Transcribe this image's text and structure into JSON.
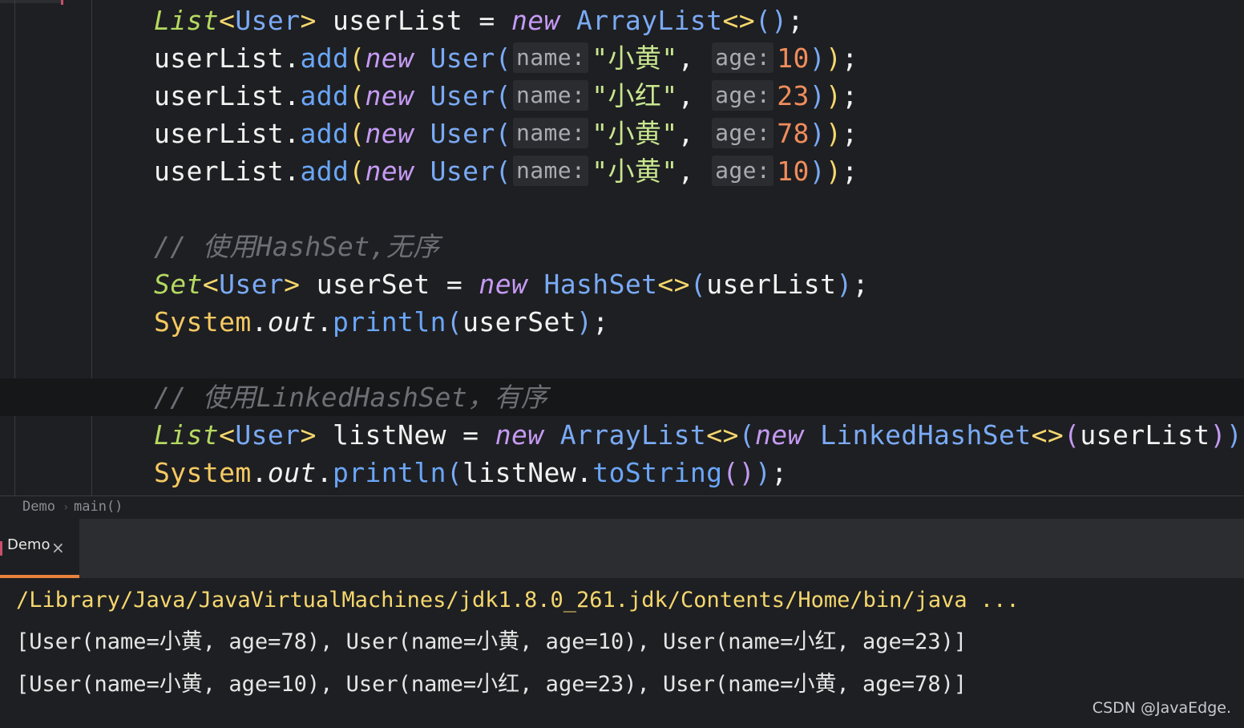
{
  "editor": {
    "lines": [
      {
        "tokens": [
          [
            "t-iface",
            "List"
          ],
          [
            "t-bracket-y",
            "<"
          ],
          [
            "t-type",
            "User"
          ],
          [
            "t-bracket-y",
            "> "
          ],
          [
            "t-var",
            "userList "
          ],
          [
            "t-punct",
            "= "
          ],
          [
            "t-kw",
            "new "
          ],
          [
            "t-type",
            "ArrayList"
          ],
          [
            "t-bracket-y",
            "<>"
          ],
          [
            "t-bracket-b",
            "()"
          ],
          [
            "t-punct",
            ";"
          ]
        ]
      },
      {
        "tokens": [
          [
            "t-var",
            "userList"
          ],
          [
            "t-punct",
            "."
          ],
          [
            "t-method",
            "add"
          ],
          [
            "t-bracket-y",
            "("
          ],
          [
            "t-kw",
            "new "
          ],
          [
            "t-type",
            "User"
          ],
          [
            "t-bracket-b",
            "("
          ]
        ],
        "hint1": "name:",
        "str": "\"小黄\"",
        "sep": ",",
        "hint2": "age:",
        "num": "10",
        "end": [
          [
            "t-bracket-b",
            ")"
          ],
          [
            "t-bracket-y",
            ")"
          ],
          [
            "t-punct",
            ";"
          ]
        ]
      },
      {
        "tokens": [
          [
            "t-var",
            "userList"
          ],
          [
            "t-punct",
            "."
          ],
          [
            "t-method",
            "add"
          ],
          [
            "t-bracket-y",
            "("
          ],
          [
            "t-kw",
            "new "
          ],
          [
            "t-type",
            "User"
          ],
          [
            "t-bracket-b",
            "("
          ]
        ],
        "hint1": "name:",
        "str": "\"小红\"",
        "sep": ",",
        "hint2": "age:",
        "num": "23",
        "end": [
          [
            "t-bracket-b",
            ")"
          ],
          [
            "t-bracket-y",
            ")"
          ],
          [
            "t-punct",
            ";"
          ]
        ]
      },
      {
        "tokens": [
          [
            "t-var",
            "userList"
          ],
          [
            "t-punct",
            "."
          ],
          [
            "t-method",
            "add"
          ],
          [
            "t-bracket-y",
            "("
          ],
          [
            "t-kw",
            "new "
          ],
          [
            "t-type",
            "User"
          ],
          [
            "t-bracket-b",
            "("
          ]
        ],
        "hint1": "name:",
        "str": "\"小黄\"",
        "sep": ",",
        "hint2": "age:",
        "num": "78",
        "end": [
          [
            "t-bracket-b",
            ")"
          ],
          [
            "t-bracket-y",
            ")"
          ],
          [
            "t-punct",
            ";"
          ]
        ]
      },
      {
        "tokens": [
          [
            "t-var",
            "userList"
          ],
          [
            "t-punct",
            "."
          ],
          [
            "t-method",
            "add"
          ],
          [
            "t-bracket-y",
            "("
          ],
          [
            "t-kw",
            "new "
          ],
          [
            "t-type",
            "User"
          ],
          [
            "t-bracket-b",
            "("
          ]
        ],
        "hint1": "name:",
        "str": "\"小黄\"",
        "sep": ",",
        "hint2": "age:",
        "num": "10",
        "end": [
          [
            "t-bracket-b",
            ")"
          ],
          [
            "t-bracket-y",
            ")"
          ],
          [
            "t-punct",
            ";"
          ]
        ]
      },
      {
        "tokens": []
      },
      {
        "tokens": [
          [
            "t-comment",
            "// 使用HashSet,无序"
          ]
        ]
      },
      {
        "tokens": [
          [
            "t-iface",
            "Set"
          ],
          [
            "t-bracket-y",
            "<"
          ],
          [
            "t-type",
            "User"
          ],
          [
            "t-bracket-y",
            "> "
          ],
          [
            "t-var",
            "userSet "
          ],
          [
            "t-punct",
            "= "
          ],
          [
            "t-kw",
            "new "
          ],
          [
            "t-type",
            "HashSet"
          ],
          [
            "t-bracket-y",
            "<>"
          ],
          [
            "t-bracket-b",
            "("
          ],
          [
            "t-var",
            "userList"
          ],
          [
            "t-bracket-b",
            ")"
          ],
          [
            "t-punct",
            ";"
          ]
        ]
      },
      {
        "tokens": [
          [
            "t-sys",
            "System"
          ],
          [
            "t-punct",
            "."
          ],
          [
            "t-field",
            "out"
          ],
          [
            "t-punct",
            "."
          ],
          [
            "t-method",
            "println"
          ],
          [
            "t-bracket-b",
            "("
          ],
          [
            "t-var",
            "userSet"
          ],
          [
            "t-bracket-b",
            ")"
          ],
          [
            "t-punct",
            ";"
          ]
        ]
      },
      {
        "tokens": []
      },
      {
        "tokens": [
          [
            "t-comment",
            "// 使用LinkedHashSet，有序"
          ]
        ]
      },
      {
        "tokens": [
          [
            "t-iface",
            "List"
          ],
          [
            "t-bracket-y",
            "<"
          ],
          [
            "t-type",
            "User"
          ],
          [
            "t-bracket-y",
            "> "
          ],
          [
            "t-var",
            "listNew "
          ],
          [
            "t-punct",
            "= "
          ],
          [
            "t-kw",
            "new "
          ],
          [
            "t-type",
            "ArrayList"
          ],
          [
            "t-bracket-y",
            "<>"
          ],
          [
            "t-bracket-b",
            "("
          ],
          [
            "t-kw",
            "new "
          ],
          [
            "t-type",
            "LinkedHashSet"
          ],
          [
            "t-bracket-y",
            "<>"
          ],
          [
            "t-bracket-p",
            "("
          ],
          [
            "t-var",
            "userList"
          ],
          [
            "t-bracket-p",
            ")"
          ],
          [
            "t-bracket-b",
            ")"
          ],
          [
            "t-punct",
            ";"
          ]
        ]
      },
      {
        "tokens": [
          [
            "t-sys",
            "System"
          ],
          [
            "t-punct",
            "."
          ],
          [
            "t-field",
            "out"
          ],
          [
            "t-punct",
            "."
          ],
          [
            "t-method",
            "println"
          ],
          [
            "t-bracket-b",
            "("
          ],
          [
            "t-var",
            "listNew"
          ],
          [
            "t-punct",
            "."
          ],
          [
            "t-method",
            "toString"
          ],
          [
            "t-bracket-p",
            "()"
          ],
          [
            "t-bracket-b",
            ")"
          ],
          [
            "t-punct",
            ";"
          ]
        ]
      }
    ]
  },
  "breadcrumb": {
    "class_name": "Demo",
    "method_name": "main()",
    "separator": "›"
  },
  "run_panel": {
    "tab_label": "Demo",
    "close_glyph": "×"
  },
  "console": {
    "command": "/Library/Java/JavaVirtualMachines/jdk1.8.0_261.jdk/Contents/Home/bin/java ...",
    "output_1": "[User(name=小黄, age=78), User(name=小黄, age=10), User(name=小红, age=23)]",
    "output_2": "[User(name=小黄, age=10), User(name=小红, age=23), User(name=小黄, age=78)]"
  },
  "watermark": "CSDN @JavaEdge."
}
